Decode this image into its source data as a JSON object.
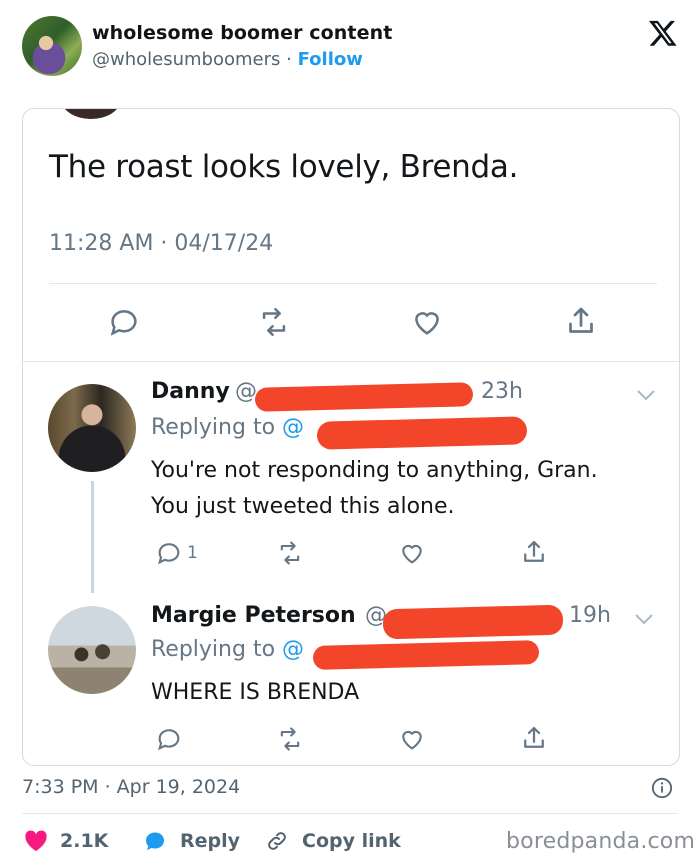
{
  "account": {
    "name": "wholesome boomer content",
    "handle": "@wholesumboomers",
    "separator": "·",
    "follow_label": "Follow"
  },
  "screenshot": {
    "main_tweet": {
      "text": "The roast looks lovely, Brenda.",
      "timestamp": "11:28 AM · 04/17/24"
    },
    "replies": [
      {
        "name": "Danny",
        "handle_prefix": "@",
        "time": "23h",
        "replying_prefix": "Replying to",
        "mention_prefix": "@",
        "lines": [
          "You're not responding to anything, Gran.",
          "You just tweeted this alone."
        ],
        "reply_count": "1"
      },
      {
        "name": "Margie Peterson",
        "handle_prefix": "@",
        "time": "19h",
        "replying_prefix": "Replying to",
        "mention_prefix": "@",
        "lines": [
          "WHERE IS BRENDA"
        ]
      }
    ]
  },
  "footer": {
    "timestamp": "7:33 PM · Apr 19, 2024",
    "like_count": "2.1K",
    "reply_label": "Reply",
    "copy_label": "Copy link",
    "watermark": "boredpanda.com"
  },
  "colors": {
    "accent": "#1d9bf0",
    "heart": "#f91880",
    "redaction": "#f2452a",
    "muted": "#536471"
  }
}
